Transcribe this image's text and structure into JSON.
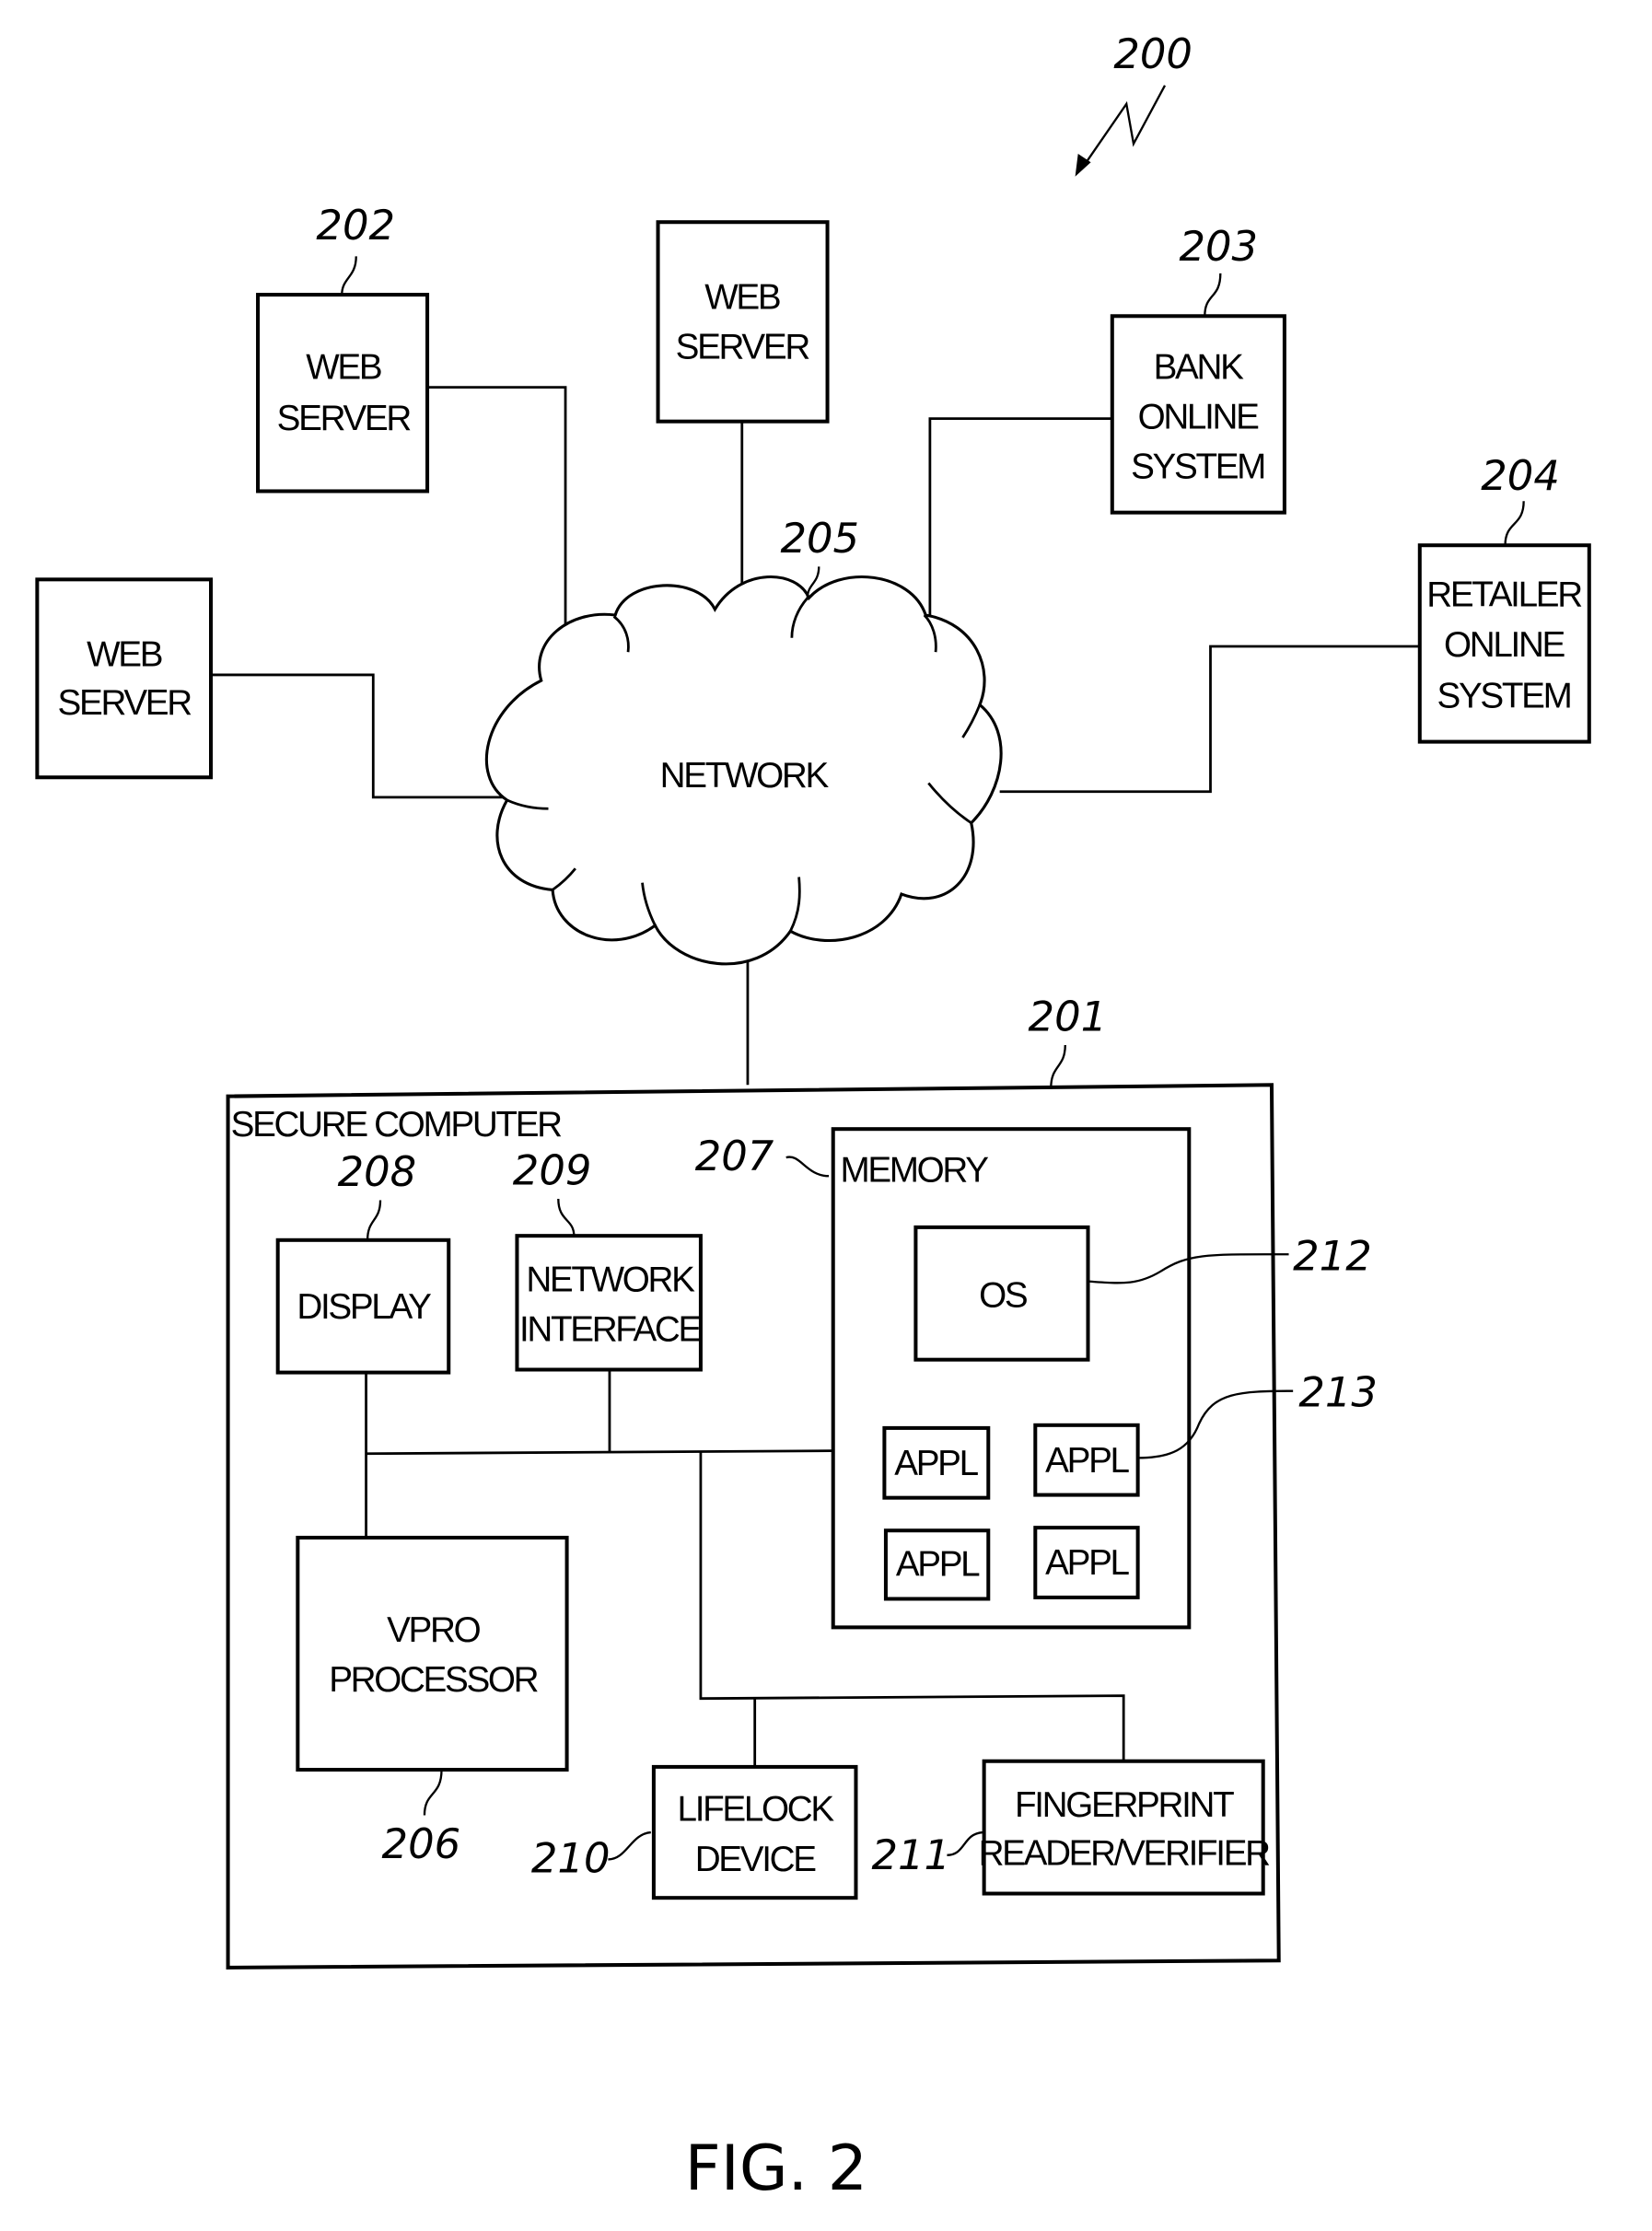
{
  "figure": {
    "caption": "FIG. 2",
    "system_ref": "200"
  },
  "network": {
    "label": "NETWORK",
    "ref": "205"
  },
  "servers": [
    {
      "line1": "WEB",
      "line2": "SERVER",
      "ref": "202"
    },
    {
      "line1": "WEB",
      "line2": "SERVER",
      "ref": ""
    },
    {
      "line1": "WEB",
      "line2": "SERVER",
      "ref": ""
    }
  ],
  "bank": {
    "lines": [
      "BANK",
      "ONLINE",
      "SYSTEM"
    ],
    "ref": "203"
  },
  "retailer": {
    "lines": [
      "RETAILER",
      "ONLINE",
      "SYSTEM"
    ],
    "ref": "204"
  },
  "secure_computer": {
    "title": "SECURE COMPUTER",
    "ref": "201",
    "display": {
      "label": "DISPLAY",
      "ref": "208"
    },
    "network_interface": {
      "line1": "NETWORK",
      "line2": "INTERFACE",
      "ref": "209"
    },
    "processor": {
      "line1": "VPRO",
      "line2": "PROCESSOR",
      "ref": "206"
    },
    "memory": {
      "title": "MEMORY",
      "ref": "207",
      "os": {
        "label": "OS",
        "ref": "212"
      },
      "apps": [
        "APPL",
        "APPL",
        "APPL",
        "APPL"
      ],
      "apps_ref": "213"
    },
    "lifelock": {
      "line1": "LIFELOCK",
      "line2": "DEVICE",
      "ref": "210"
    },
    "fingerprint": {
      "line1": "FINGERPRINT",
      "line2": "READER/VERIFIER",
      "ref": "211"
    }
  }
}
